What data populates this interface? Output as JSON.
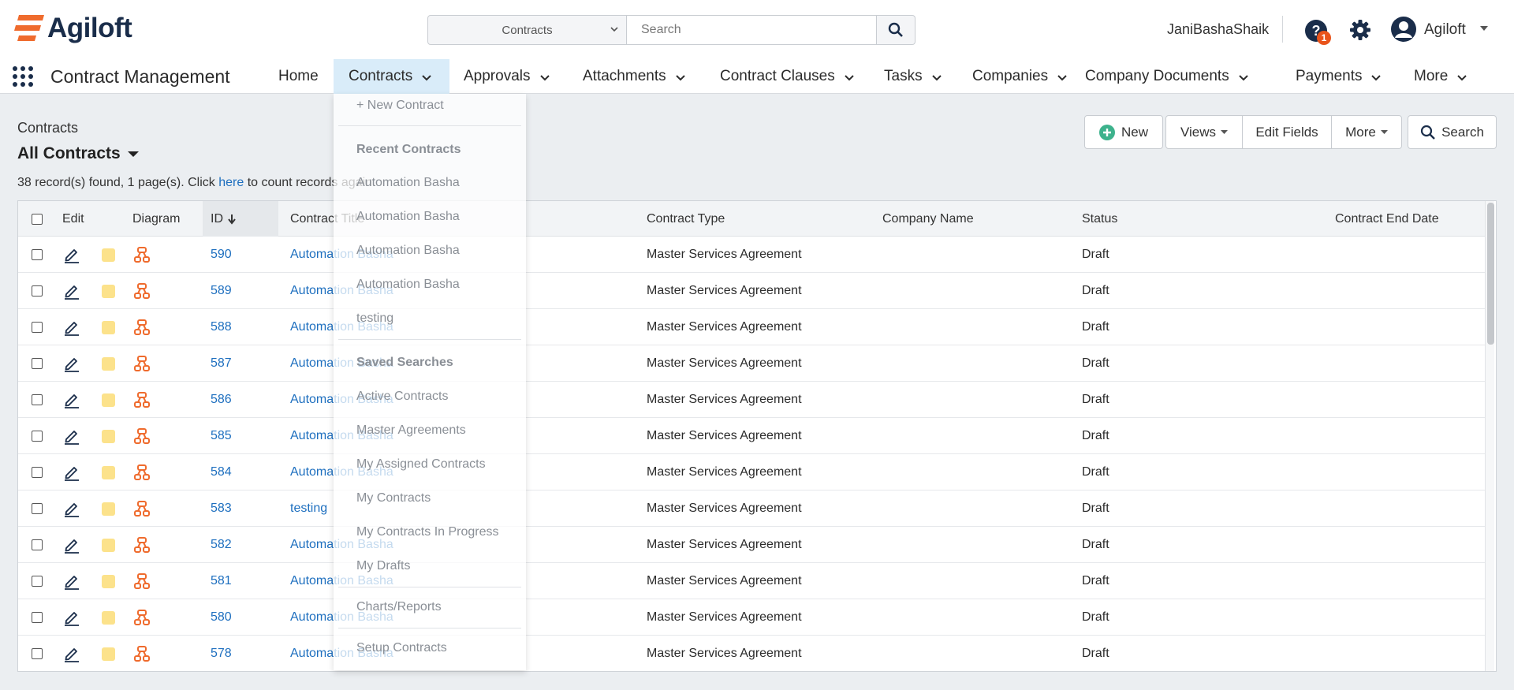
{
  "header": {
    "logo_text": "Agiloft",
    "search_scope": "Contracts",
    "search_placeholder": "Search",
    "user_name": "JaniBashaShaik",
    "help_badge": "1",
    "account_label": "Agiloft"
  },
  "nav": {
    "module_title": "Contract Management",
    "items": [
      "Home",
      "Contracts",
      "Approvals",
      "Attachments",
      "Contract Clauses",
      "Tasks",
      "Companies",
      "Company Documents",
      "Payments",
      "More"
    ]
  },
  "content": {
    "breadcrumb": "Contracts",
    "view_title": "All Contracts",
    "records_prefix": "38 record(s) found, 1 page(s). Click ",
    "records_link": "here",
    "records_suffix": " to count records again"
  },
  "actions": {
    "new_label": "New",
    "views_label": "Views",
    "edit_fields_label": "Edit Fields",
    "more_label": "More",
    "search_label": "Search"
  },
  "table": {
    "columns": [
      "Edit",
      "Diagram",
      "ID",
      "Contract Title",
      "Contract Type",
      "Company Name",
      "Status",
      "Contract End Date"
    ],
    "rows": [
      {
        "id": "590",
        "title": "Automation Basha",
        "type": "Master Services Agreement",
        "company": "",
        "status": "Draft",
        "end_date": ""
      },
      {
        "id": "589",
        "title": "Automation Basha",
        "type": "Master Services Agreement",
        "company": "",
        "status": "Draft",
        "end_date": ""
      },
      {
        "id": "588",
        "title": "Automation Basha",
        "type": "Master Services Agreement",
        "company": "",
        "status": "Draft",
        "end_date": ""
      },
      {
        "id": "587",
        "title": "Automation Basha",
        "type": "Master Services Agreement",
        "company": "",
        "status": "Draft",
        "end_date": ""
      },
      {
        "id": "586",
        "title": "Automation Basha",
        "type": "Master Services Agreement",
        "company": "",
        "status": "Draft",
        "end_date": ""
      },
      {
        "id": "585",
        "title": "Automation Basha",
        "type": "Master Services Agreement",
        "company": "",
        "status": "Draft",
        "end_date": ""
      },
      {
        "id": "584",
        "title": "Automation Basha",
        "type": "Master Services Agreement",
        "company": "",
        "status": "Draft",
        "end_date": ""
      },
      {
        "id": "583",
        "title": "testing",
        "type": "Master Services Agreement",
        "company": "",
        "status": "Draft",
        "end_date": ""
      },
      {
        "id": "582",
        "title": "Automation Basha",
        "type": "Master Services Agreement",
        "company": "",
        "status": "Draft",
        "end_date": ""
      },
      {
        "id": "581",
        "title": "Automation Basha",
        "type": "Master Services Agreement",
        "company": "",
        "status": "Draft",
        "end_date": ""
      },
      {
        "id": "580",
        "title": "Automation Basha",
        "type": "Master Services Agreement",
        "company": "",
        "status": "Draft",
        "end_date": ""
      },
      {
        "id": "578",
        "title": "Automation Basha",
        "type": "Master Services Agreement",
        "company": "",
        "status": "Draft",
        "end_date": ""
      }
    ]
  },
  "dropdown": {
    "new_contract": "+ New Contract",
    "recent_heading": "Recent Contracts",
    "recent": [
      "Automation Basha",
      "Automation Basha",
      "Automation Basha",
      "Automation Basha",
      "testing"
    ],
    "saved_heading": "Saved Searches",
    "saved": [
      "Active Contracts",
      "Master Agreements",
      "My Assigned Contracts",
      "My Contracts",
      "My Contracts In Progress",
      "My Drafts"
    ],
    "charts_reports": "Charts/Reports",
    "setup": "Setup Contracts"
  },
  "colors": {
    "accent_orange": "#ef6b2d",
    "link_blue": "#1e6fbf",
    "active_nav_bg": "#d9ecf9",
    "new_plus_green": "#3db28c"
  }
}
